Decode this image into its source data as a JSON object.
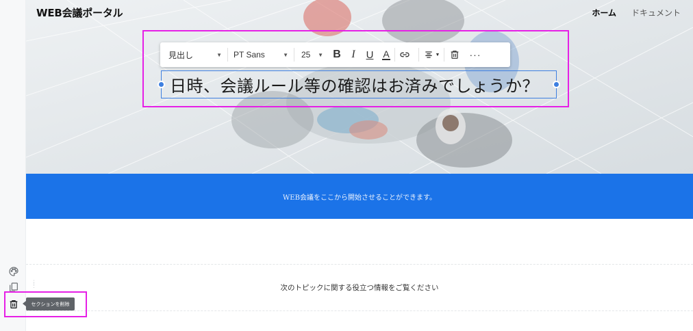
{
  "header": {
    "site_title": "WEB会議ポータル",
    "nav": [
      {
        "label": "ホーム",
        "active": true
      },
      {
        "label": "ドキュメント",
        "active": false
      }
    ]
  },
  "toolbar": {
    "block_style": "見出し",
    "font_family": "PT Sans",
    "font_size": "25",
    "bold_icon": "bold-icon",
    "italic_icon": "italic-icon",
    "underline_icon": "underline-icon",
    "text_color_icon": "text-color-icon",
    "link_icon": "link-icon",
    "align_icon": "align-center-icon",
    "delete_icon": "trash-icon",
    "more_icon": "more-icon"
  },
  "hero": {
    "heading": "日時、会議ルール等の確認はお済みでしょうか？"
  },
  "banner": {
    "text": "WEB会議をここから開始させることができます。",
    "color": "#1b73e8"
  },
  "topics": {
    "text": "次のトピックに関する役立つ情報をご覧ください"
  },
  "rail": {
    "palette_icon": "palette-icon",
    "duplicate_icon": "duplicate-icon",
    "delete_icon": "trash-icon",
    "delete_tooltip": "セクションを削除"
  },
  "colors": {
    "highlight": "#e61fe6",
    "selection": "#3d7fe0"
  }
}
